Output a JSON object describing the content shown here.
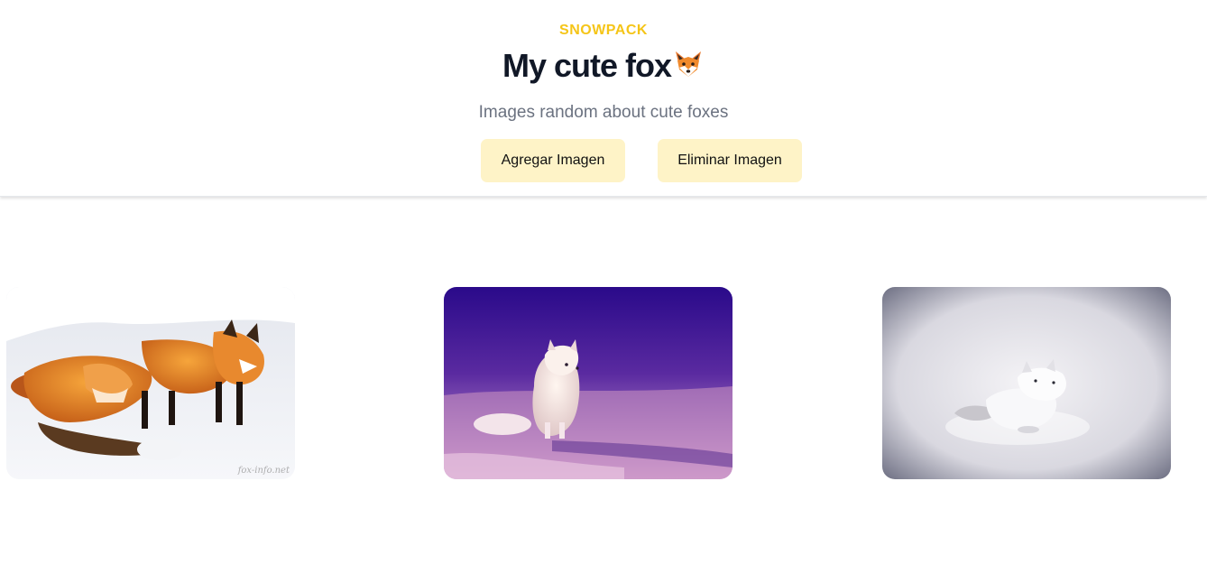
{
  "header": {
    "brand": "SNOWPACK",
    "title": "My cute fox",
    "title_emoji": "fox-face-emoji",
    "subtitle": "Images random about cute foxes",
    "add_button_label": "Agregar Imagen",
    "remove_button_label": "Eliminar Imagen"
  },
  "gallery": {
    "images": [
      {
        "subject": "three red foxes in snow",
        "watermark": "fox-info.net"
      },
      {
        "subject": "arctic fox sitting on purple-tinted snow"
      },
      {
        "subject": "white arctic fox lying in snow"
      }
    ]
  },
  "colors": {
    "brand": "#f5c518",
    "title": "#111827",
    "subtitle": "#6b7280",
    "button_bg": "#fef3c7"
  }
}
